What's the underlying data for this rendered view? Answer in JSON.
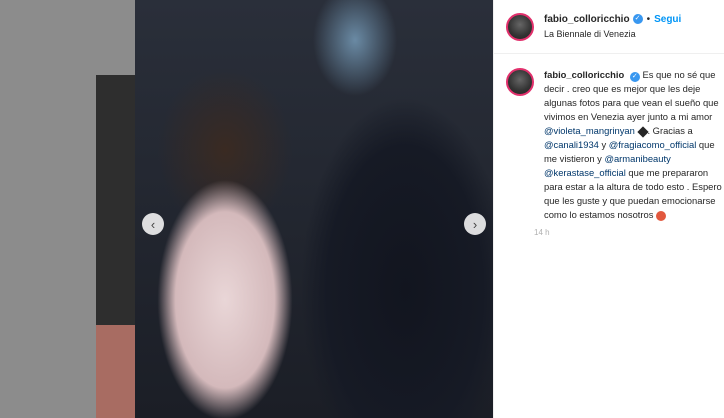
{
  "post": {
    "username": "fabio_colloricchio",
    "follow_label": "Segui",
    "separator": "•",
    "location": "La Biennale di Venezia",
    "prev_arrow": "‹",
    "next_arrow": "›",
    "caption": {
      "username": "fabio_colloricchio",
      "part1": "Es que no sé que decir . creo que es mejor que les deje algunas fotos para que vean el sueño que vivimos en Venezia ayer junto a mi amor",
      "mention1": "@violeta_mangrinyan",
      "part2": "Gracias a",
      "mention2": "@canali1934",
      "part3": "y",
      "mention3": "@fragiacomo_official",
      "part4": "que me vistieron y",
      "mention4": "@armanibeauty",
      "mention5": "@kerastase_official",
      "part5": "que me prepararon para estar a la altura de todo esto . Espero que les guste y que puedan emocionarse como lo estamos nosotros"
    },
    "time_label": "14 h"
  },
  "colors": {
    "accent": "#0095f6",
    "verified": "#3897f0",
    "mention": "#00376b"
  }
}
